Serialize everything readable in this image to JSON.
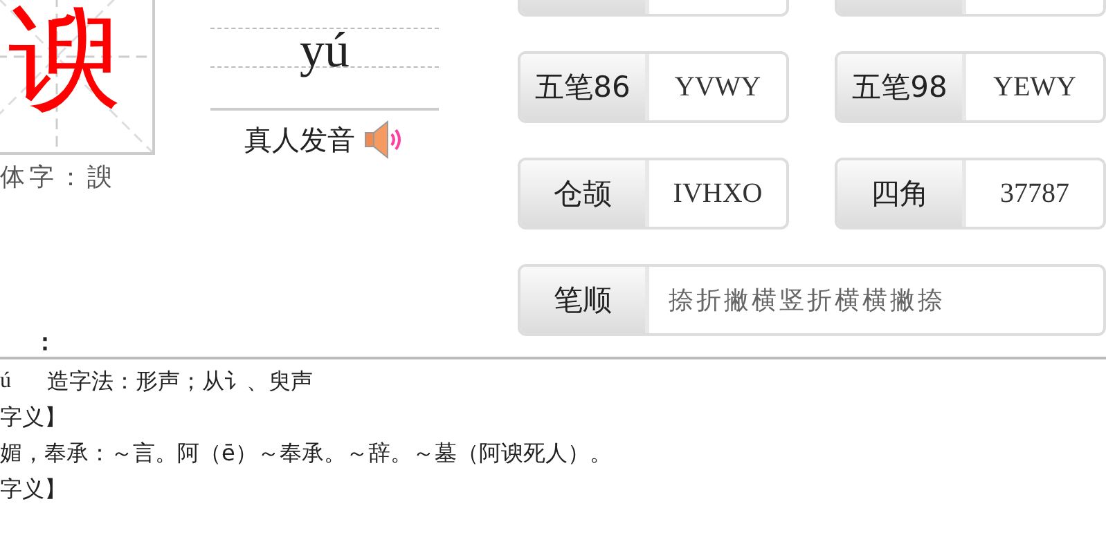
{
  "character": {
    "glyph": "谀",
    "variant": "体字：諛"
  },
  "pinyin": {
    "reading": "yú",
    "audio_label": "真人发音"
  },
  "codes": [
    {
      "label": "五笔86",
      "value": "YVWY"
    },
    {
      "label": "五笔98",
      "value": "YEWY"
    },
    {
      "label": "仓颉",
      "value": "IVHXO"
    },
    {
      "label": "四角",
      "value": "37787"
    }
  ],
  "stroke_order": {
    "label": "笔顺",
    "value": "捺折撇横竖折横横撇捺"
  },
  "section_heading": "：",
  "lines": [
    {
      "reading": "ú",
      "text": "造字法：形声；从讠、臾声"
    },
    {
      "text": "字义】"
    },
    {
      "text": "媚，奉承：～言。阿（ē）～奉承。～辞。～墓（阿谀死人）。"
    },
    {
      "text": "字义】"
    }
  ]
}
